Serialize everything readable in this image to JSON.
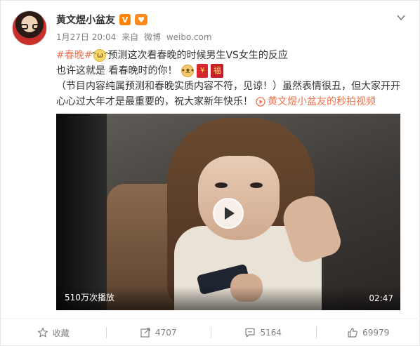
{
  "post": {
    "username": "黄文煜小盆友",
    "verified_badge": "V",
    "timestamp": "1月27日 20:04",
    "source_prefix": "来自",
    "source": "微博",
    "source_url": "weibo.com",
    "text": {
      "hashtag": "#春晚#",
      "line1_rest": "预测这次看春晚的时候男生VS女生的反应",
      "line2": "也许这就是 看春晚时的你！",
      "line3": "（节目内容纯属预测和春晚实质内容不符，见谅！）虽然表情很丑，但大家开开",
      "line4_text": "心心过大年才是最重要的，祝大家新年快乐！",
      "video_link": "黄文煜小盆友的秒拍视频"
    },
    "video": {
      "play_count": "510万次播放",
      "duration": "02:47"
    }
  },
  "actions": {
    "favorite_label": "收藏",
    "repost_count": "4707",
    "comment_count": "5164",
    "like_count": "69979"
  },
  "icons": {
    "verified": "verified-v-icon",
    "member": "member-badge-icon",
    "menu": "chevron-down-icon",
    "play": "play-icon",
    "favorite": "star-icon",
    "repost": "repost-icon",
    "comment": "comment-icon",
    "like": "thumbs-up-icon"
  },
  "colors": {
    "link": "#eb7350",
    "muted": "#808080",
    "badge": "#ff8200"
  }
}
